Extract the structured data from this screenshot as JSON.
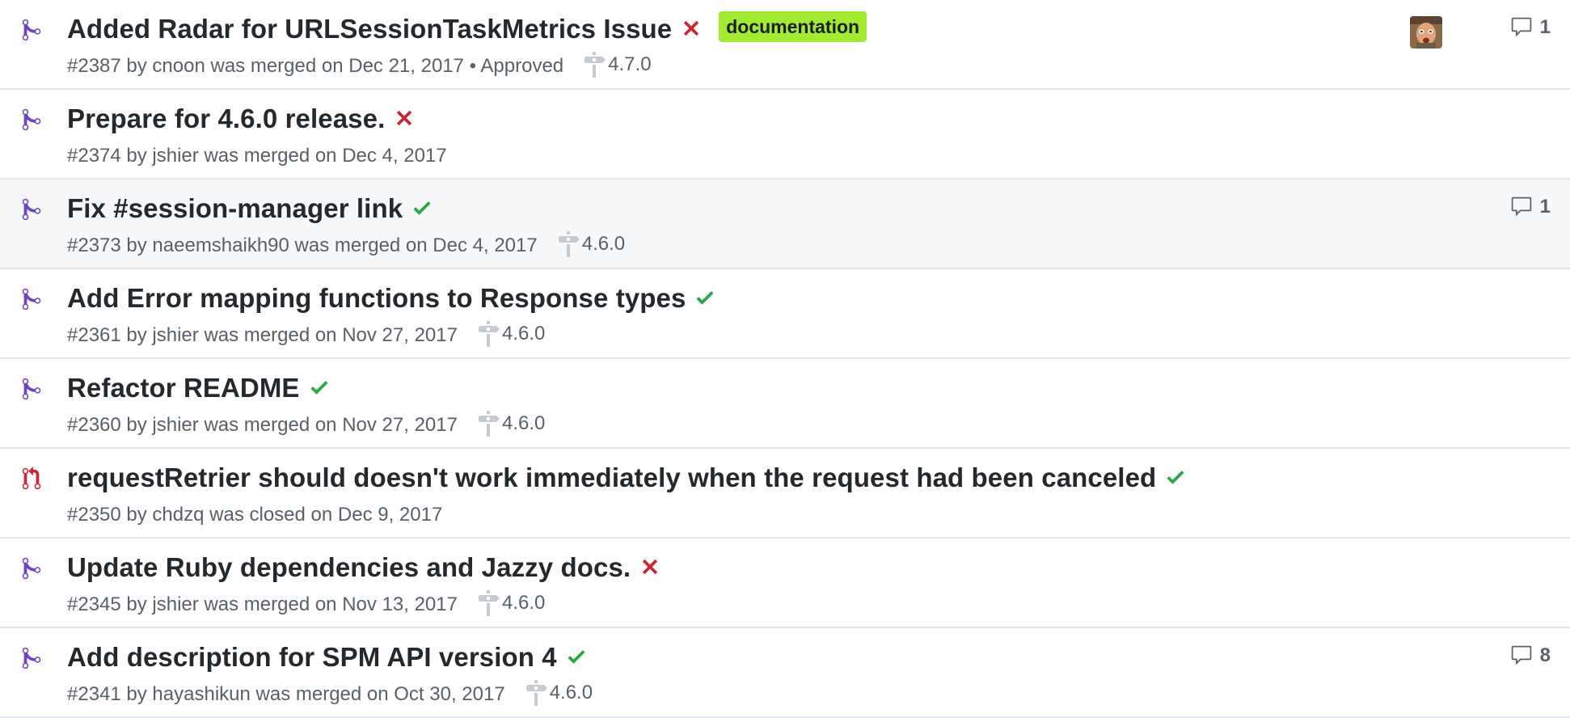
{
  "colors": {
    "merged": "#6f42c1",
    "closed": "#cb2431",
    "success": "#28a745",
    "failure": "#cb2431",
    "label_documentation_bg": "#a2eb32",
    "label_documentation_text": "#1b1f23",
    "row_border": "#e1e4e8",
    "row_highlight": "#f6f8fa"
  },
  "pull_requests": [
    {
      "title": "Added Radar for URLSessionTaskMetrics Issue",
      "state": "merged",
      "state_icon": "git-merge-icon",
      "status": "failure",
      "status_icon": "x-icon",
      "label": "documentation",
      "meta": "#2387 by cnoon was merged on Dec 21, 2017 • Approved",
      "milestone": "4.7.0",
      "has_avatar": true,
      "comments": "1",
      "highlight": false
    },
    {
      "title": "Prepare for 4.6.0 release.",
      "state": "merged",
      "state_icon": "git-merge-icon",
      "status": "failure",
      "status_icon": "x-icon",
      "meta": "#2374 by jshier was merged on Dec 4, 2017",
      "highlight": false
    },
    {
      "title": "Fix #session-manager link",
      "state": "merged",
      "state_icon": "git-merge-icon",
      "status": "success",
      "status_icon": "check-icon",
      "meta": "#2373 by naeemshaikh90 was merged on Dec 4, 2017",
      "milestone": "4.6.0",
      "comments": "1",
      "highlight": true
    },
    {
      "title": "Add Error mapping functions to Response types",
      "state": "merged",
      "state_icon": "git-merge-icon",
      "status": "success",
      "status_icon": "check-icon",
      "meta": "#2361 by jshier was merged on Nov 27, 2017",
      "milestone": "4.6.0",
      "highlight": false
    },
    {
      "title": "Refactor README",
      "state": "merged",
      "state_icon": "git-merge-icon",
      "status": "success",
      "status_icon": "check-icon",
      "meta": "#2360 by jshier was merged on Nov 27, 2017",
      "milestone": "4.6.0",
      "highlight": false
    },
    {
      "title": "requestRetrier should doesn't work immediately when the request had been canceled",
      "state": "closed",
      "state_icon": "git-pull-request-closed-icon",
      "status": "success",
      "status_icon": "check-icon",
      "meta": "#2350 by chdzq was closed on Dec 9, 2017",
      "highlight": false
    },
    {
      "title": "Update Ruby dependencies and Jazzy docs.",
      "state": "merged",
      "state_icon": "git-merge-icon",
      "status": "failure",
      "status_icon": "x-icon",
      "meta": "#2345 by jshier was merged on Nov 13, 2017",
      "milestone": "4.6.0",
      "highlight": false
    },
    {
      "title": "Add description for SPM API version 4",
      "state": "merged",
      "state_icon": "git-merge-icon",
      "status": "success",
      "status_icon": "check-icon",
      "meta": "#2341 by hayashikun was merged on Oct 30, 2017",
      "milestone": "4.6.0",
      "comments": "8",
      "highlight": false
    }
  ]
}
